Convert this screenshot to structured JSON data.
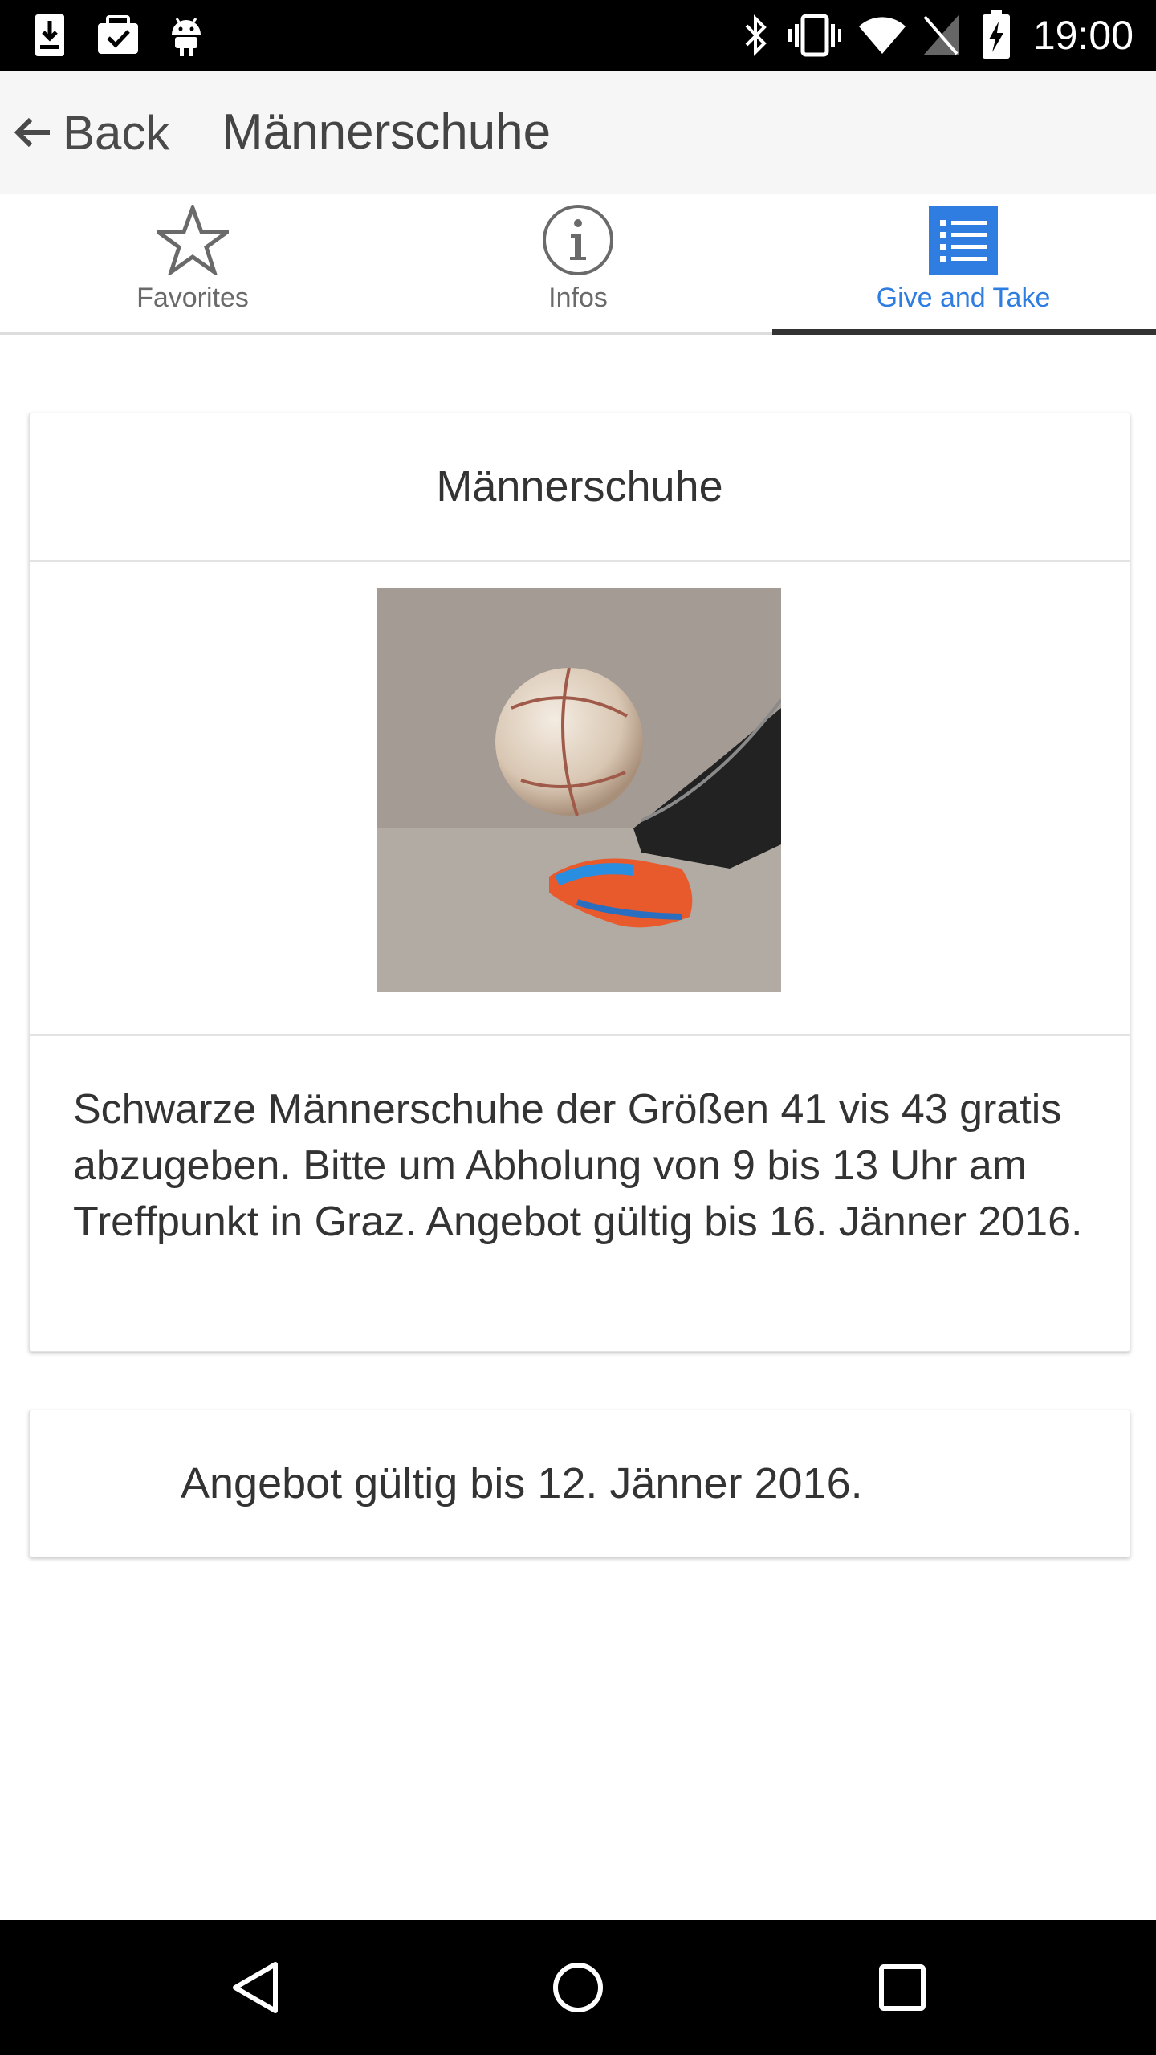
{
  "status_bar": {
    "time": "19:00",
    "left_icons": [
      "download-icon",
      "briefcase-check-icon",
      "android-icon"
    ],
    "right_icons": [
      "bluetooth-icon",
      "vibrate-icon",
      "wifi-icon",
      "no-sim-icon",
      "battery-charging-icon"
    ]
  },
  "header": {
    "back_label": "Back",
    "title": "Männerschuhe"
  },
  "tabs": [
    {
      "label": "Favorites",
      "icon": "star-icon",
      "active": false
    },
    {
      "label": "Infos",
      "icon": "info-icon",
      "active": false
    },
    {
      "label": "Give and Take",
      "icon": "list-icon",
      "active": true
    }
  ],
  "offer": {
    "title": "Männerschuhe",
    "image": "football-shoe-photo",
    "description": "Schwarze Männerschuhe der Größen 41 vis 43 gratis abzugeben. Bitte um Abholung von 9 bis 13 Uhr am Treffpunkt in Graz. Angebot gültig bis 16. Jänner 2016.",
    "validity": "Angebot gültig bis 12. Jänner 2016."
  },
  "colors": {
    "accent": "#2f7de1",
    "header_bg": "#f6f6f6",
    "text": "#333333"
  },
  "nav_bar": [
    "back-nav-icon",
    "home-nav-icon",
    "recents-nav-icon"
  ]
}
